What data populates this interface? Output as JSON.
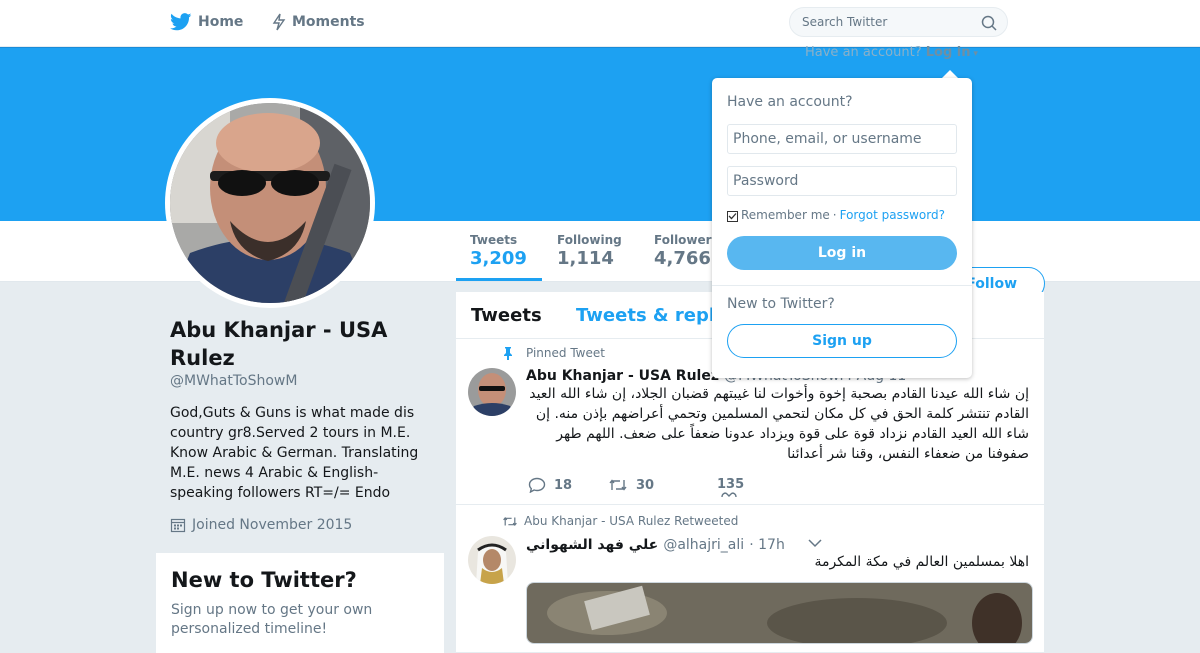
{
  "nav": {
    "home_label": "Home",
    "moments_label": "Moments",
    "search_placeholder": "Search Twitter",
    "have_account_text": "Have an account?",
    "login_link": "Log in"
  },
  "profile": {
    "name": "Abu Khanjar - USA Rulez",
    "handle": "@MWhatToShowM",
    "bio": "God,Guts & Guns is what made dis country gr8.Served 2 tours in M.E. Know Arabic & German. Translating M.E. news 4 Arabic & English-speaking followers RT=/= Endo",
    "joined": "Joined November 2015"
  },
  "stats": [
    {
      "label": "Tweets",
      "value": "3,209"
    },
    {
      "label": "Following",
      "value": "1,114"
    },
    {
      "label": "Followers",
      "value": "4,766"
    }
  ],
  "follow_label": "Follow",
  "new_to_twitter": {
    "title": "New to Twitter?",
    "subtitle": "Sign up now to get your own personalized timeline!"
  },
  "timeline": {
    "tabs": [
      "Tweets",
      "Tweets & replies"
    ],
    "tweets": [
      {
        "context": "Pinned Tweet",
        "name": "Abu Khanjar - USA Rulez",
        "handle": "@MWhatToShowM",
        "time": "Aug 11",
        "text": "إن شاء الله عيدنا القادم بصحبة إخوة وأخوات لنا غيبتهم قضبان الجلاد، إن شاء الله العيد القادم تنتشر كلمة الحق في كل مكان لتحمي المسلمين وتحمي أعراضهم بإذن منه. إن شاء الله العيد القادم نزداد قوة على قوة ويزداد عدونا ضعفاً على ضعف. اللهم طهر صفوفنا من ضعفاء النفس، وقنا شر أعدائنا",
        "replies": "18",
        "retweets": "30",
        "likes": "135"
      },
      {
        "context": "Abu Khanjar - USA Rulez Retweeted",
        "name": "علي فهد الشهواني",
        "handle": "@alhajri_ali",
        "time": "· 17h",
        "text": "اهلا بمسلمين العالم في مكة المكرمة"
      }
    ]
  },
  "login_dropdown": {
    "heading": "Have an account?",
    "username_placeholder": "Phone, email, or username",
    "password_placeholder": "Password",
    "remember_label": "Remember me",
    "separator": "·",
    "forgot_label": "Forgot password?",
    "login_button": "Log in",
    "new_heading": "New to Twitter?",
    "signup_button": "Sign up"
  },
  "colors": {
    "brand": "#1da1f2",
    "banner": "#1da1f2",
    "text_secondary": "#657786"
  }
}
